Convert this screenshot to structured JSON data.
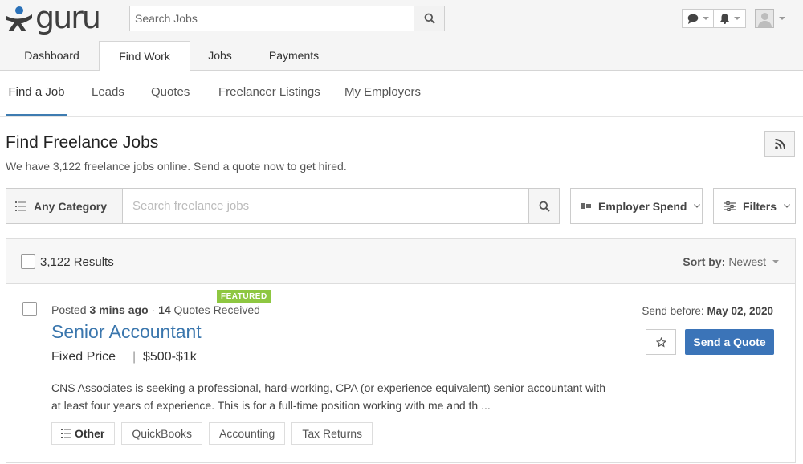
{
  "brand": {
    "name": "guru"
  },
  "header": {
    "search_placeholder": "Search Jobs"
  },
  "main_tabs": [
    {
      "label": "Dashboard"
    },
    {
      "label": "Find Work"
    },
    {
      "label": "Jobs"
    },
    {
      "label": "Payments"
    }
  ],
  "sub_nav": [
    {
      "label": "Find a Job"
    },
    {
      "label": "Leads"
    },
    {
      "label": "Quotes"
    },
    {
      "label": "Freelancer Listings"
    },
    {
      "label": "My Employers"
    }
  ],
  "page": {
    "title": "Find Freelance Jobs",
    "subtitle": "We have 3,122 freelance jobs online. Send a quote now to get hired."
  },
  "filters": {
    "category_label": "Any Category",
    "search_placeholder": "Search freelance jobs",
    "employer_spend_label": "Employer Spend",
    "filters_label": "Filters"
  },
  "results": {
    "count_text": "3,122 Results",
    "sort_prefix": "Sort by:",
    "sort_value": "Newest"
  },
  "job": {
    "posted_prefix": "Posted",
    "posted_time": "3 mins ago",
    "quotes_count": "14",
    "quotes_label": "Quotes Received",
    "title": "Senior Accountant",
    "badge": "FEATURED",
    "price_type": "Fixed Price",
    "price_separator": "|",
    "price": "$500-$1k",
    "description": "CNS Associates is seeking a professional, hard-working, CPA (or experience equivalent) senior accountant with at least four years of experience. This is for a full-time position working with me and th ...",
    "send_before_label": "Send before:",
    "send_before_date": "May 02, 2020",
    "quote_button": "Send a Quote",
    "tags": [
      "Other",
      "QuickBooks",
      "Accounting",
      "Tax Returns"
    ]
  },
  "colors": {
    "accent": "#3b74b8",
    "link": "#3a76ad",
    "featured": "#8ec741"
  }
}
